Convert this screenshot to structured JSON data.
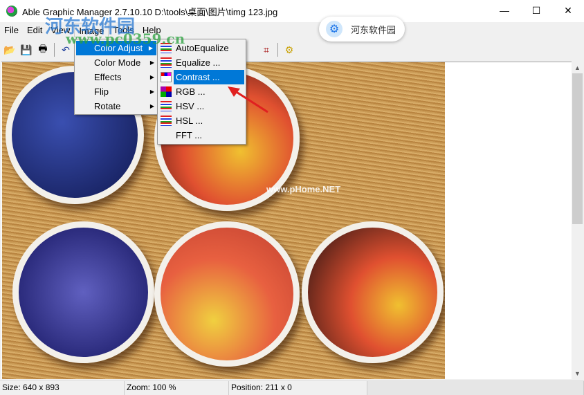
{
  "window": {
    "title": "Able Graphic Manager 2.7.10.10 D:\\tools\\桌面\\图片\\timg 123.jpg",
    "minimize": "—",
    "maximize": "☐",
    "close": "✕"
  },
  "menubar": [
    "File",
    "Edit",
    "View",
    "Image",
    "Tools",
    "Help"
  ],
  "toolbar": [
    {
      "icon": "open-folder-icon",
      "glyph": "📂"
    },
    {
      "icon": "save-icon",
      "glyph": "💾"
    },
    {
      "icon": "print-icon",
      "glyph": "🖶"
    },
    {
      "icon": "undo-icon",
      "glyph": "↶"
    },
    {
      "icon": "crop-icon",
      "glyph": "⌗"
    },
    {
      "icon": "plugin-icon",
      "glyph": "⚙"
    }
  ],
  "image_menu": {
    "items": [
      {
        "label": "Color Adjust",
        "highlighted": true
      },
      {
        "label": "Color Mode"
      },
      {
        "label": "Effects"
      },
      {
        "label": "Flip"
      },
      {
        "label": "Rotate"
      }
    ],
    "submenu_arrow": "▶"
  },
  "color_adjust_submenu": {
    "items": [
      {
        "label": "AutoEqualize",
        "icon": "autoequalize-icon"
      },
      {
        "label": "Equalize ...",
        "icon": "equalize-icon"
      },
      {
        "label": "Contrast ...",
        "icon": "contrast-icon",
        "highlighted": true
      },
      {
        "label": "RGB ...",
        "icon": "rgb-icon"
      },
      {
        "label": "HSV ...",
        "icon": "hsv-icon"
      },
      {
        "label": "HSL ...",
        "icon": "hsl-icon"
      },
      {
        "label": "FFT ...",
        "icon": ""
      }
    ]
  },
  "image_watermark": "www.pHome.NET",
  "overlay_badge": {
    "text": "河东软件园",
    "icon": "gear-icon",
    "glyph": "⚙"
  },
  "site_watermark": {
    "name": "河东软件园",
    "url": "www.pc0359.cn"
  },
  "scrollbar": {
    "up": "▲",
    "down": "▼"
  },
  "status": {
    "size": "Size: 640 x 893",
    "zoom": "Zoom: 100 %",
    "position": "Position: 211 x 0"
  },
  "colors": {
    "highlight": "#0078d7",
    "arrow": "#e02020"
  }
}
